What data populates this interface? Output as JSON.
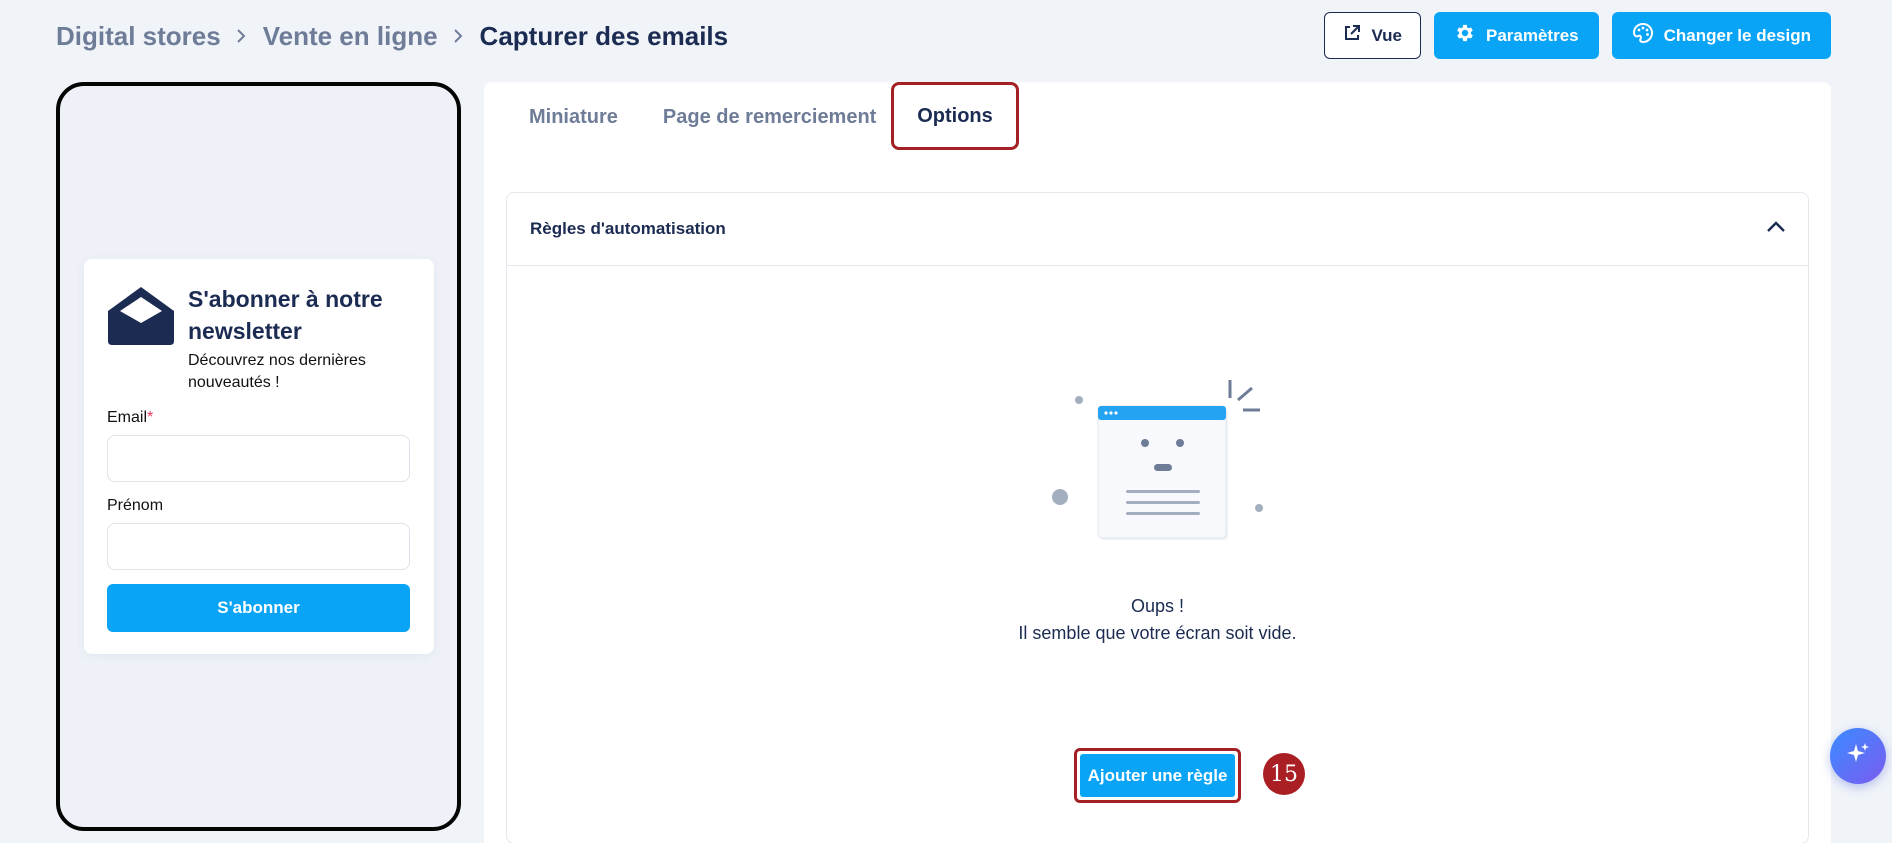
{
  "breadcrumb": {
    "items": [
      "Digital stores",
      "Vente en ligne",
      "Capturer des emails"
    ]
  },
  "header": {
    "view_label": "Vue",
    "settings_label": "Paramètres",
    "design_label": "Changer le design"
  },
  "preview": {
    "title": "S'abonner à notre newsletter",
    "subtitle": "Découvrez nos dernières nouveautés !",
    "email_label": "Email",
    "required_mark": "*",
    "firstname_label": "Prénom",
    "subscribe_label": "S'abonner"
  },
  "tabs": [
    {
      "label": "Miniature",
      "active": false
    },
    {
      "label": "Page de remerciement",
      "active": false
    },
    {
      "label": "Options",
      "active": true
    }
  ],
  "accordion": {
    "title": "Règles d'automatisation",
    "expanded": true
  },
  "empty_state": {
    "line1": "Oups !",
    "line2": "Il semble que votre écran soit vide."
  },
  "add_rule_label": "Ajouter une règle",
  "step_badge": "15",
  "colors": {
    "primary": "#0aa4f6",
    "navy": "#1b2b52",
    "highlight": "#a32024",
    "background": "#f0f3f8"
  }
}
